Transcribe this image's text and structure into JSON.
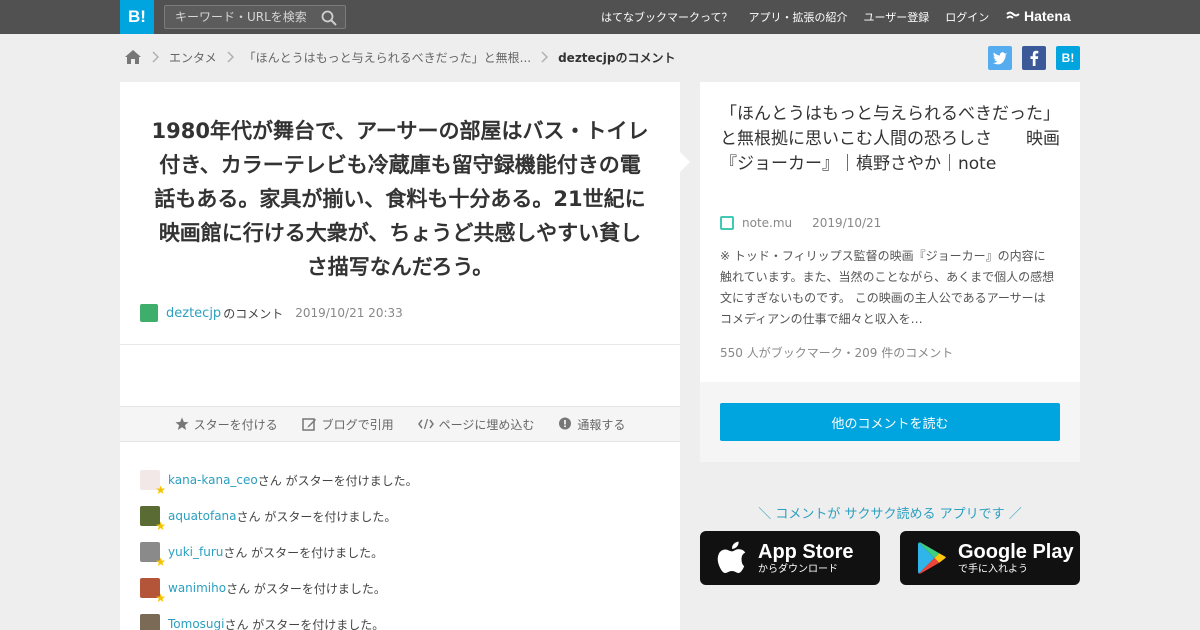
{
  "header": {
    "logo": "B!",
    "search_placeholder": "キーワード・URLを検索",
    "nav": [
      "はてなブックマークって？",
      "アプリ・拡張の紹介",
      "ユーザー登録",
      "ログイン"
    ],
    "brand": "Hatena"
  },
  "breadcrumb": {
    "items": [
      "エンタメ",
      "「ほんとうはもっと与えられるべきだった」と無根..."
    ],
    "current": "deztecjpのコメント"
  },
  "comment": {
    "text": "1980年代が舞台で、アーサーの部屋はバス・トイレ付き、カラーテレビも冷蔵庫も留守録機能付きの電話もある。家具が揃い、食料も十分ある。21世紀に映画館に行ける大衆が、ちょうど共感しやすい貧しさ描写なんだろう。",
    "user": "deztecjp",
    "user_suffix": "のコメント",
    "date": "2019/10/21 20:33"
  },
  "actions": [
    "スターを付ける",
    "ブログで引用",
    "ページに埋め込む",
    "通報する"
  ],
  "stars": {
    "suffix": "さん がスターを付けました。",
    "users": [
      "kana-kana_ceo",
      "aquatofana",
      "yuki_furu",
      "wanimiho",
      "Tomosugi"
    ]
  },
  "entry": {
    "title": "「ほんとうはもっと与えられるべきだった」と無根拠に思いこむ人間の恐ろしさ　　映画『ジョーカー』｜槙野さやか｜note",
    "source": "note.mu",
    "date": "2019/10/21",
    "excerpt": "※ トッド・フィリップス監督の映画『ジョーカー』の内容に触れています。また、当然のことながら、あくまで個人の感想文にすぎないものです。 この映画の主人公であるアーサーはコメディアンの仕事で細々と収入を…",
    "counts": "550 人がブックマーク・209 件のコメント",
    "more_button": "他のコメントを読む"
  },
  "promo": {
    "text": "＼ コメントが サクサク読める アプリです ／",
    "appstore_big": "App Store",
    "appstore_small": "からダウンロード",
    "googleplay_big": "Google Play",
    "googleplay_small": "で手に入れよう"
  },
  "colors": {
    "topbar": "#515151",
    "accent": "#00a4de",
    "link": "#2b9fc0",
    "star": "#f5c400"
  }
}
